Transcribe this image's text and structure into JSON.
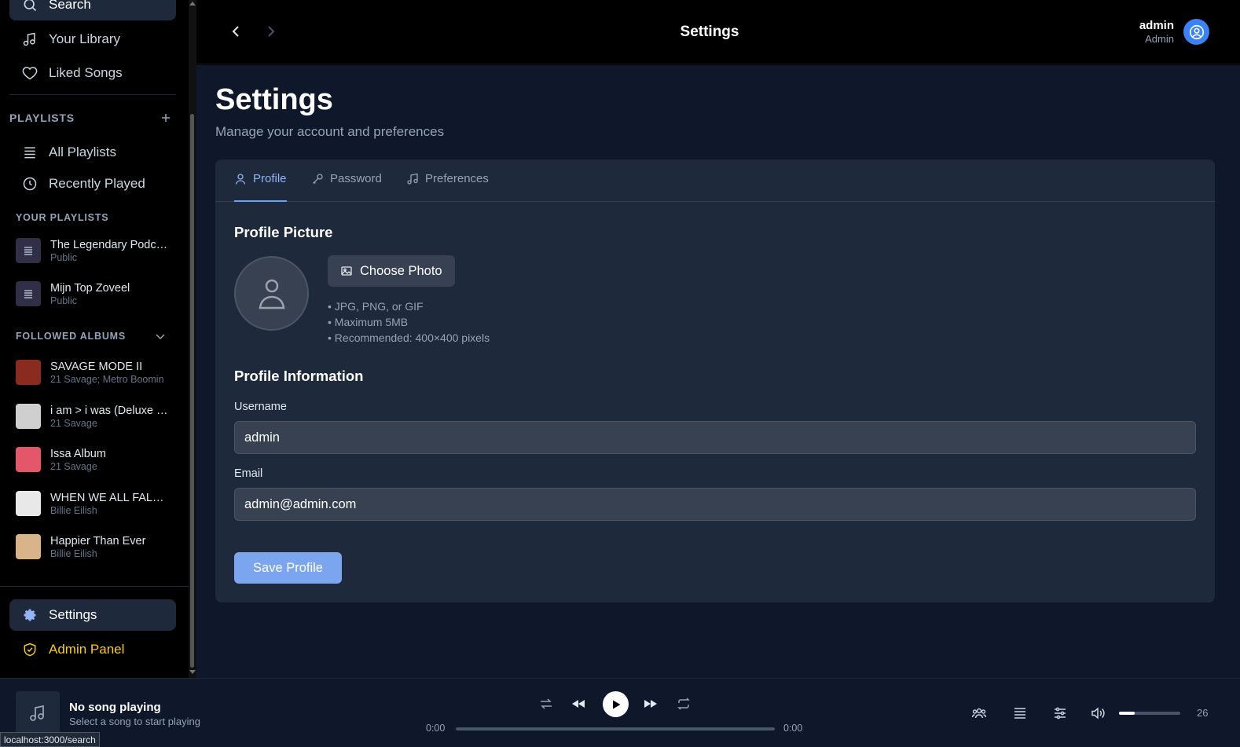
{
  "sidebar": {
    "search_label": "Search",
    "library_label": "Your Library",
    "liked_label": "Liked Songs",
    "playlists_title": "PLAYLISTS",
    "all_playlists_label": "All Playlists",
    "recently_played_label": "Recently Played",
    "your_playlists_title": "YOUR PLAYLISTS",
    "playlists": [
      {
        "name": "The Legendary Podcast",
        "sub": "Public"
      },
      {
        "name": "Mijn Top Zoveel",
        "sub": "Public"
      }
    ],
    "followed_albums_title": "FOLLOWED ALBUMS",
    "albums": [
      {
        "name": "SAVAGE MODE II",
        "sub": "21 Savage; Metro Boomin",
        "color": "#8b2a1e"
      },
      {
        "name": "i am > i was (Deluxe Edition)",
        "sub": "21 Savage",
        "color": "#cfcfcf"
      },
      {
        "name": "Issa Album",
        "sub": "21 Savage",
        "color": "#e4566a"
      },
      {
        "name": "WHEN WE ALL FALL ASLEEP, WHERE DO WE GO?",
        "sub": "Billie Eilish",
        "color": "#e8e8e8"
      },
      {
        "name": "Happier Than Ever",
        "sub": "Billie Eilish",
        "color": "#d9b48a"
      }
    ],
    "settings_label": "Settings",
    "admin_label": "Admin Panel"
  },
  "header": {
    "title": "Settings",
    "user_name": "admin",
    "user_role": "Admin"
  },
  "main": {
    "title": "Settings",
    "subtitle": "Manage your account and preferences",
    "tabs": [
      {
        "label": "Profile"
      },
      {
        "label": "Password"
      },
      {
        "label": "Preferences"
      }
    ],
    "picture_title": "Profile Picture",
    "choose_photo_label": "Choose Photo",
    "hints": [
      "• JPG, PNG, or GIF",
      "• Maximum 5MB",
      "• Recommended: 400×400 pixels"
    ],
    "info_title": "Profile Information",
    "username_label": "Username",
    "username_value": "admin",
    "email_label": "Email",
    "email_value": "admin@admin.com",
    "save_label": "Save Profile"
  },
  "player": {
    "title": "No song playing",
    "subtitle": "Select a song to start playing",
    "current_time": "0:00",
    "total_time": "0:00",
    "progress": 0,
    "volume": 26,
    "volume_text": "26"
  },
  "status_url": "localhost:3000/search",
  "colors": {
    "accent": "#60a5fa",
    "admin": "#facc15",
    "save_button": "#7ca5ef"
  }
}
